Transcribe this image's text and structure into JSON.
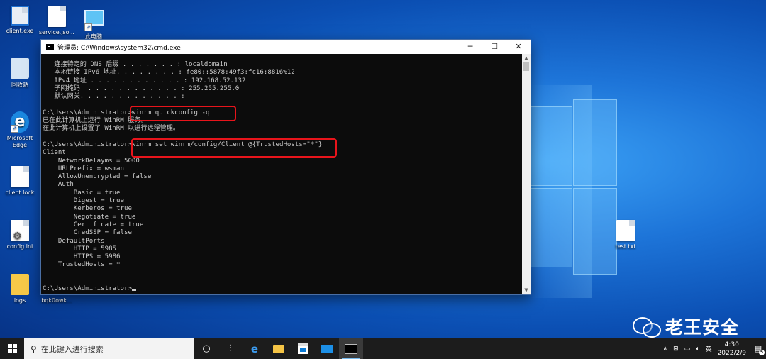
{
  "desktop": {
    "icons": [
      {
        "label": "client.exe"
      },
      {
        "label": "service.jso..."
      },
      {
        "label": "此电脑"
      },
      {
        "label": "回收站"
      },
      {
        "label": "Microsoft Edge"
      },
      {
        "label": "client.lock"
      },
      {
        "label": "config.ini"
      },
      {
        "label": "logs"
      },
      {
        "label": "bqk0owk..."
      },
      {
        "label": "test.txt"
      }
    ]
  },
  "window": {
    "title": "管理员: C:\\Windows\\system32\\cmd.exe",
    "minimize": "─",
    "maximize": "☐",
    "close": "✕"
  },
  "console": {
    "lines": [
      "   连接特定的 DNS 后缀 . . . . . . . : localdomain",
      "   本地链接 IPv6 地址. . . . . . . . : fe80::5878:49f3:fc16:8816%12",
      "   IPv4 地址 . . . . . . . . . . . . : 192.168.52.132",
      "   子网掩码  . . . . . . . . . . . . : 255.255.255.0",
      "   默认网关. . . . . . . . . . . . . :",
      "",
      "C:\\Users\\Administrator>winrm quickconfig -q",
      "已在此计算机上运行 WinRM 服务。",
      "在此计算机上设置了 WinRM 以进行远程管理。",
      "",
      "C:\\Users\\Administrator>winrm set winrm/config/Client @{TrustedHosts=\"*\"}",
      "Client",
      "    NetworkDelayms = 5000",
      "    URLPrefix = wsman",
      "    AllowUnencrypted = false",
      "    Auth",
      "        Basic = true",
      "        Digest = true",
      "        Kerberos = true",
      "        Negotiate = true",
      "        Certificate = true",
      "        CredSSP = false",
      "    DefaultPorts",
      "        HTTP = 5985",
      "        HTTPS = 5986",
      "    TrustedHosts = *",
      "",
      "",
      "C:\\Users\\Administrator>"
    ]
  },
  "watermark": {
    "text": "老王安全"
  },
  "taskbar": {
    "search_placeholder": "在此键入进行搜索",
    "tray_ime": "英",
    "tray_arrow": "∧",
    "time": "4:30",
    "date": "2022/2/9",
    "notification_count": "5"
  },
  "colors": {
    "highlight_border": "#e8141b",
    "console_text": "#cccccc",
    "console_bg": "#0c0c0c",
    "taskbar_bg": "#1c1c1c"
  }
}
